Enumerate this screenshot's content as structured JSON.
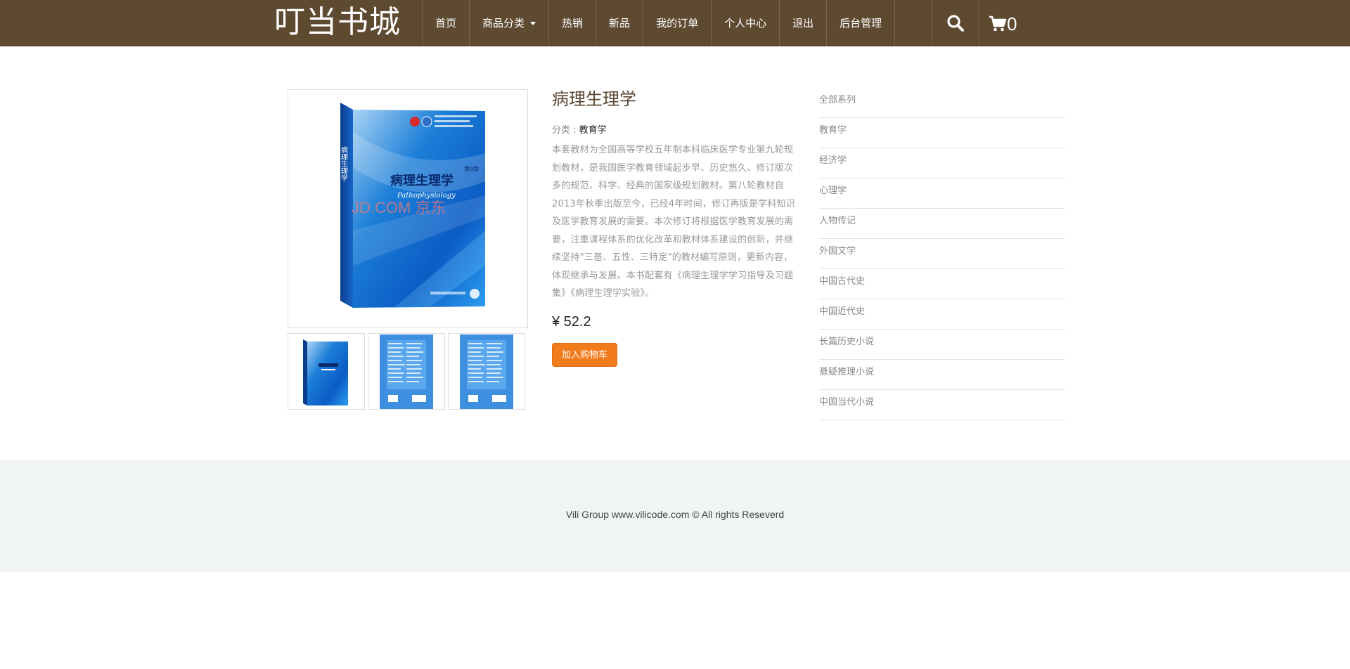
{
  "header": {
    "logo": "叮当书城",
    "nav": [
      {
        "label": "首页",
        "name": "nav-home"
      },
      {
        "label": "商品分类",
        "name": "nav-categories"
      },
      {
        "label": "热销",
        "name": "nav-hot"
      },
      {
        "label": "新品",
        "name": "nav-new"
      },
      {
        "label": "我的订单",
        "name": "nav-orders"
      },
      {
        "label": "个人中心",
        "name": "nav-profile"
      },
      {
        "label": "退出",
        "name": "nav-logout"
      },
      {
        "label": "后台管理",
        "name": "nav-admin"
      }
    ],
    "cart_count": "0",
    "search_icon": "search-icon",
    "cart_icon": "cart-icon"
  },
  "product": {
    "title": "病理生理学",
    "category_label": "分类 : ",
    "category_value": "教育学",
    "description": "本套教材为全国高等学校五年制本科临床医学专业第九轮规划教材，是我国医学教育领域起步早、历史悠久、修订版次多的规范、科学、经典的国家级规划教材。第八轮教材自2013年秋季出版至今，已经4年时间，修订再版是学科知识及医学教育发展的需要。本次修订将根据医学教育发展的需要，注重课程体系的优化改革和教材体系建设的创新，并继续坚持\"三基、五性、三特定\"的教材编写原则，更新内容，体现继承与发展。本书配套有《病理生理学学习指导及习题集》《病理生理学实验》。",
    "price": "¥ 52.2",
    "add_to_cart": "加入购物车",
    "cover": {
      "title": "病理生理学",
      "subtitle": "Pathophysiology",
      "edition": "第9版",
      "watermark": "JD.COM 京东"
    }
  },
  "sidebar": {
    "items": [
      "全部系列",
      "教育学",
      "经济学",
      "心理学",
      "人物传记",
      "外国文学",
      "中国古代史",
      "中国近代史",
      "长篇历史小说",
      "悬疑推理小说",
      "中国当代小说"
    ]
  },
  "footer": {
    "text": "Vili Group www.vilicode.com © All rights Reseverd"
  },
  "colors": {
    "header_bg": "#5e4a30",
    "button_orange": "#f27b1c",
    "footer_bg": "#f1f4f4"
  }
}
